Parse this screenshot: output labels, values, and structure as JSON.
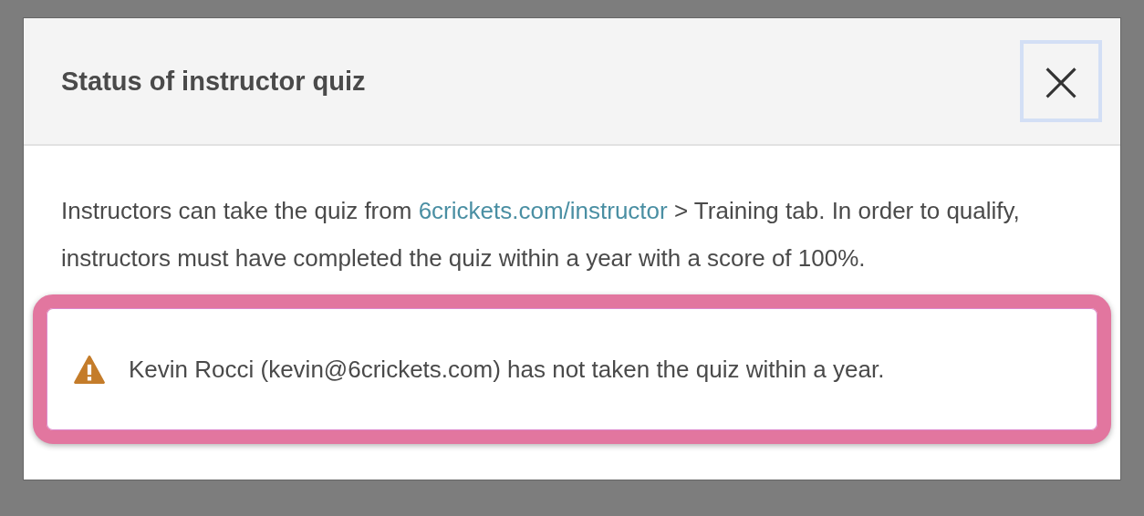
{
  "dialog": {
    "title": "Status of instructor quiz",
    "close_button": "×",
    "body": {
      "before_link": "Instructors can take the quiz from ",
      "link": "6crickets.com/instructor",
      "after_link": " > Training tab. In order to qualify, instructors must have completed the quiz within a year with a score of 100%."
    },
    "alert": {
      "kind": "warning",
      "highlighted": true,
      "message": "Kevin Rocci (kevin@6crickets.com) has not taken the quiz within a year."
    }
  }
}
